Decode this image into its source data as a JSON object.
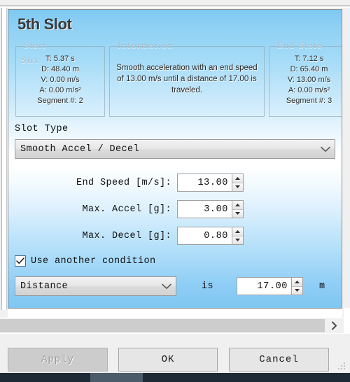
{
  "window": {
    "title": "5th Slot"
  },
  "start_group": {
    "legend": "Start",
    "ghost_text": "Strt",
    "rows": [
      "T: 5.37 s",
      "D: 48.40 m",
      "V: 0.00 m/s",
      "A: 0.00 m/s²",
      "Segment #: 2"
    ]
  },
  "information_group": {
    "legend": "Information",
    "text": "Smooth acceleration with an end speed of 13.00 m/s until a distance of 17.00 is traveled."
  },
  "end_state_group": {
    "legend": "End State",
    "rows": [
      "T: 7.12 s",
      "D: 65.40 m",
      "V: 13.00 m/s",
      "A: 0.00 m/s²",
      "Segment #: 3"
    ]
  },
  "slot_type": {
    "label": "Slot Type",
    "selected": "Smooth Accel / Decel",
    "chevron_icon": "chevron-down-icon"
  },
  "fields": [
    {
      "label": "End Speed [m/s]:",
      "value": "13.00",
      "name": "end-speed"
    },
    {
      "label": "Max. Accel [g]:",
      "value": "3.00",
      "name": "max-accel"
    },
    {
      "label": "Max. Decel [g]:",
      "value": "0.80",
      "name": "max-decel"
    }
  ],
  "condition": {
    "checkbox_label": "Use another condition",
    "checkbox_checked": true,
    "check_icon": "check-icon",
    "type_selected": "Distance",
    "is_label": "is",
    "value": "17.00",
    "unit": "m"
  },
  "scrollbar": {
    "arrow_icon": "chevron-right-icon"
  },
  "buttons": {
    "apply": "Apply",
    "ok": "OK",
    "cancel": "Cancel"
  },
  "colors": {
    "panel_top_blue": "#7ec8f2",
    "panel_mid_white": "#ffffff",
    "panel_bottom_blue": "#7ec6f2",
    "chrome_grey": "#f0f0f0",
    "taskbar": "#1e2a36"
  }
}
